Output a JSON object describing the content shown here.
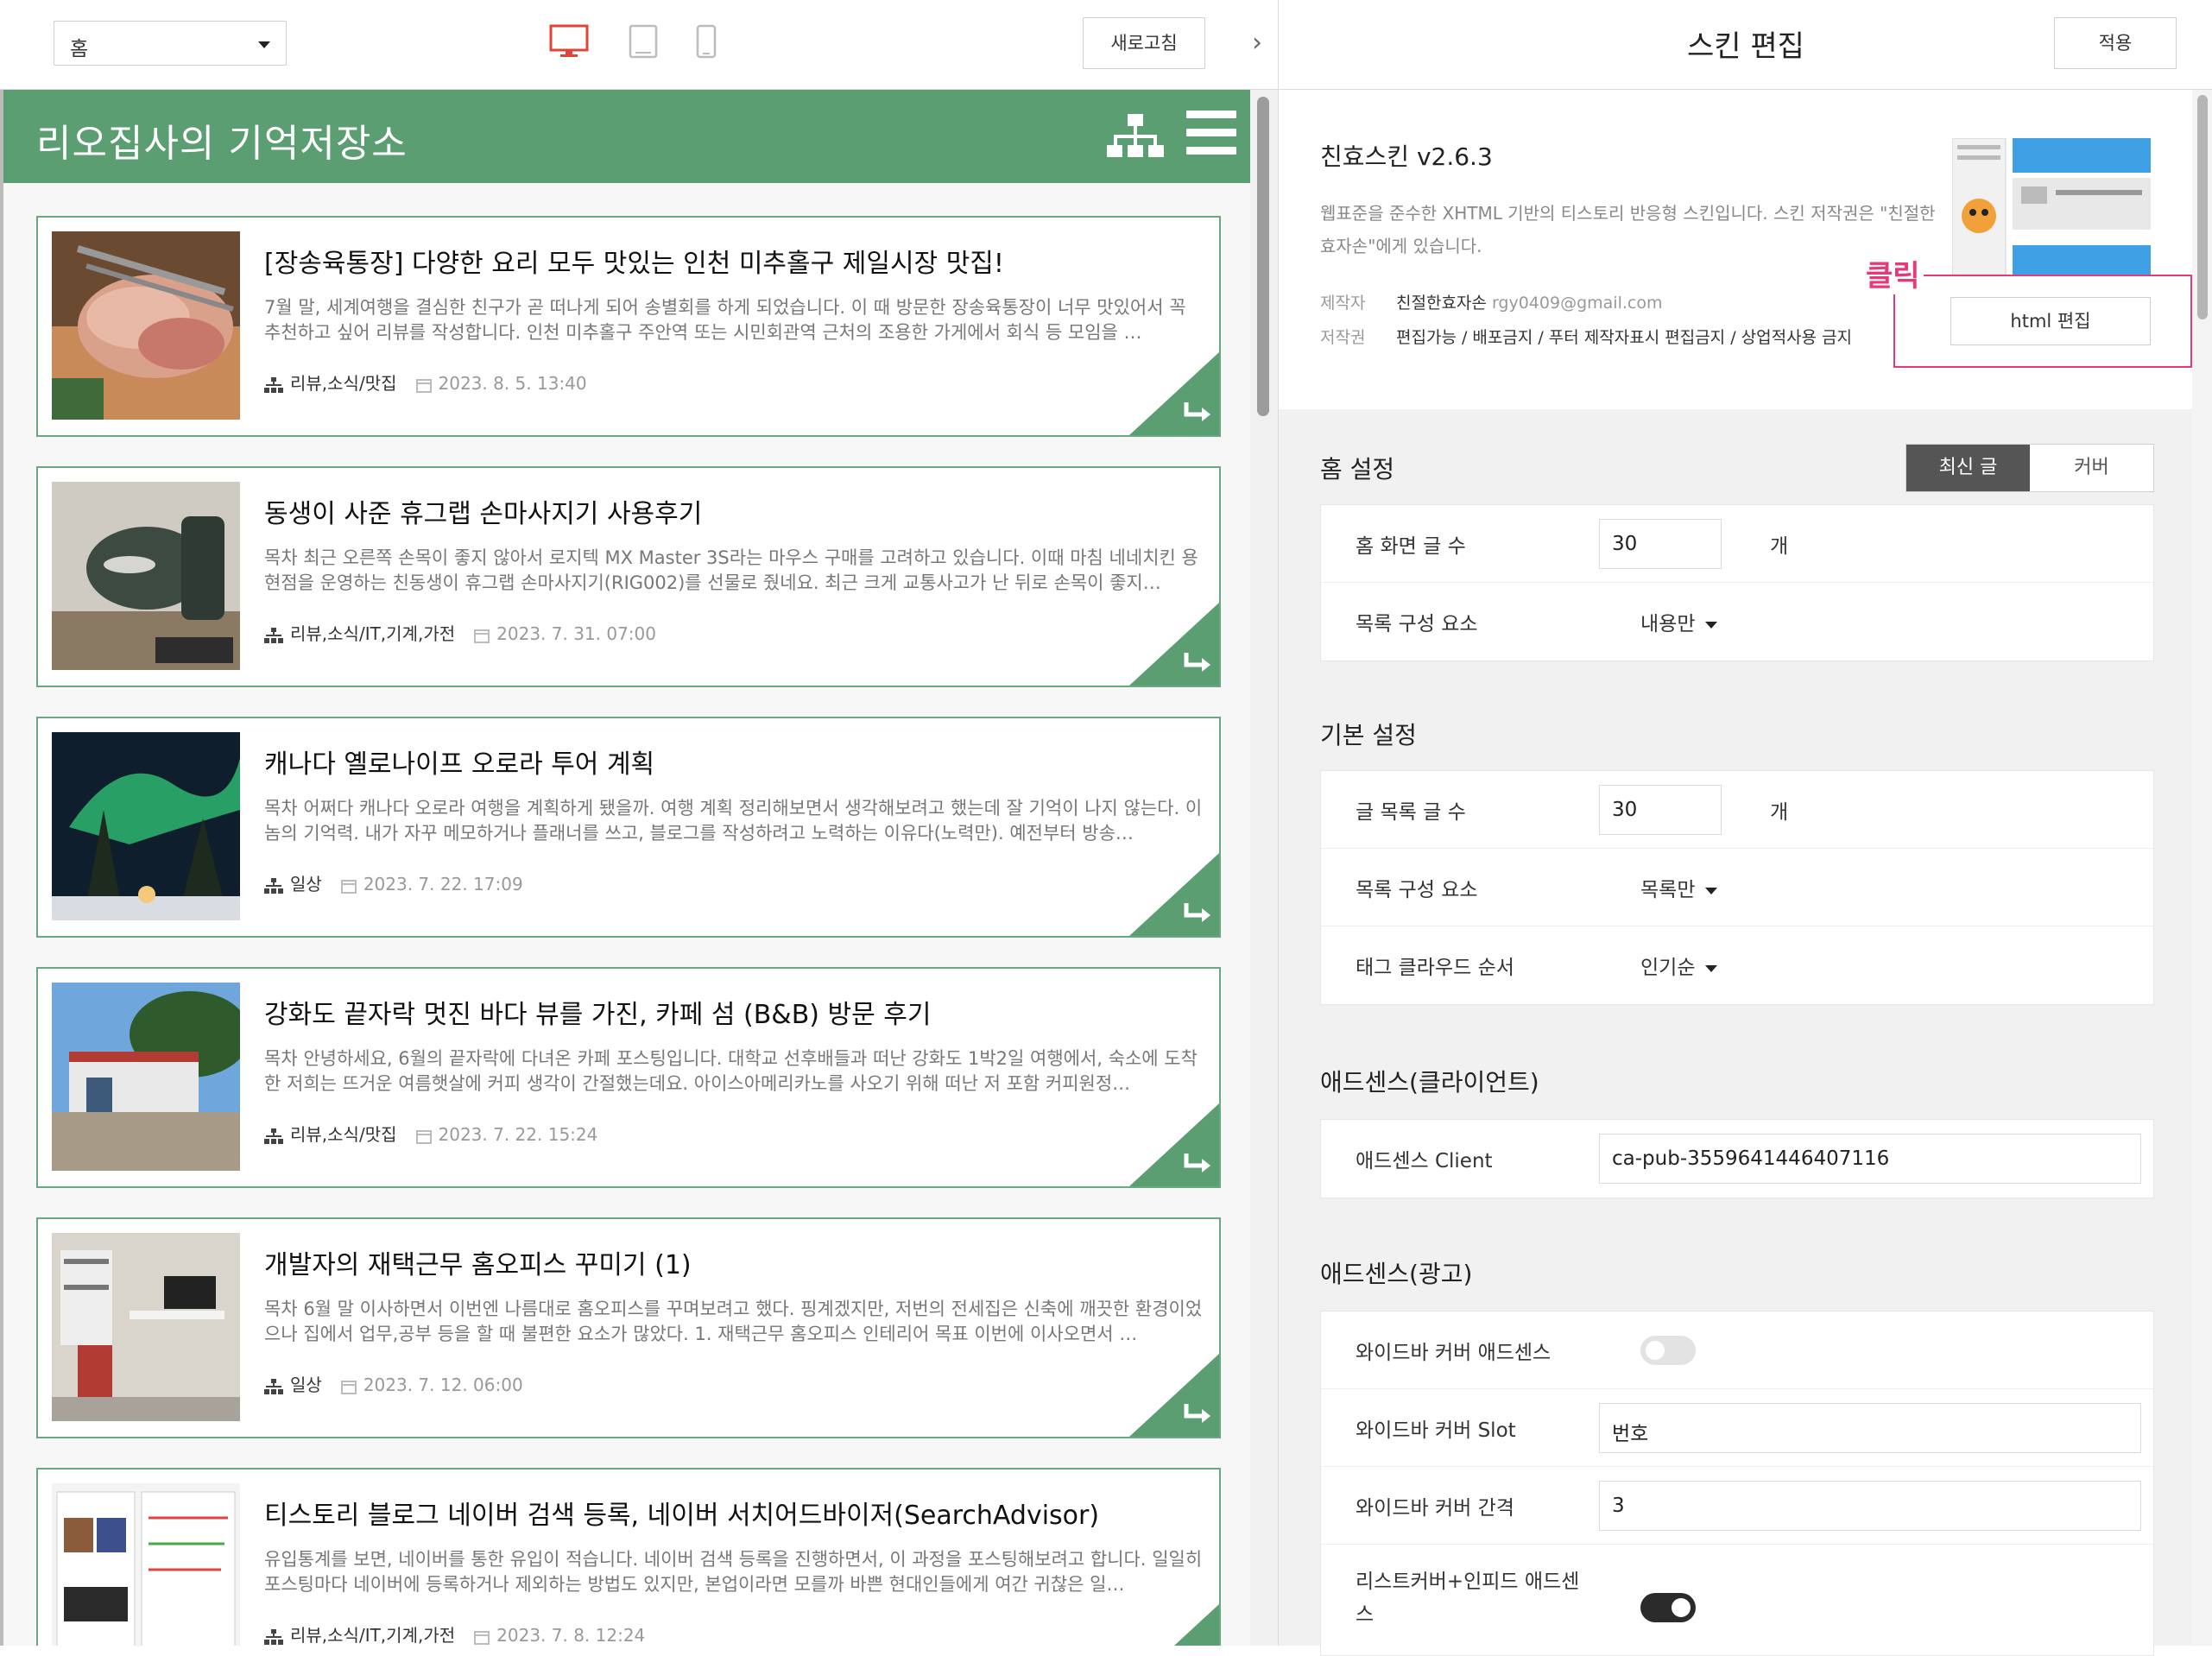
{
  "toolbar": {
    "page_select_value": "홈",
    "refresh_label": "새로고침",
    "collapse_glyph": "›"
  },
  "blog": {
    "title": "리오집사의 기억저장소",
    "posts": [
      {
        "title": "[장송육통장] 다양한 요리 모두 맛있는 인천 미추홀구 제일시장 맛집!",
        "excerpt": "7월 말, 세계여행을 결심한 친구가 곧 떠나게 되어 송별회를 하게 되었습니다. 이 때 방문한 장송육통장이 너무 맛있어서 꼭 추천하고 싶어 리뷰를 작성합니다. 인천 미추홀구 주안역 또는 시민회관역 근처의 조용한 가게에서 회식 등 모임을 …",
        "category": "리뷰,소식/맛집",
        "date": "2023. 8. 5. 13:40"
      },
      {
        "title": "동생이 사준 휴그랩 손마사지기 사용후기",
        "excerpt": "목차 최근 오른쪽 손목이 좋지 않아서 로지텍 MX Master 3S라는 마우스 구매를 고려하고 있습니다. 이때 마침 네네치킨 용현점을 운영하는 친동생이 휴그랩 손마사지기(RIG002)를 선물로 줬네요. 최근 크게 교통사고가 난 뒤로 손목이 좋지…",
        "category": "리뷰,소식/IT,기계,가전",
        "date": "2023. 7. 31. 07:00"
      },
      {
        "title": "캐나다 옐로나이프 오로라 투어 계획",
        "excerpt": "목차 어쩌다 캐나다 오로라 여행을 계획하게 됐을까. 여행 계획 정리해보면서 생각해보려고 했는데 잘 기억이 나지 않는다. 이놈의 기억력. 내가 자꾸 메모하거나 플래너를 쓰고, 블로그를 작성하려고 노력하는 이유다(노력만). 예전부터 방송…",
        "category": "일상",
        "date": "2023. 7. 22. 17:09"
      },
      {
        "title": "강화도 끝자락 멋진 바다 뷰를 가진, 카페 섬 (B&B) 방문 후기",
        "excerpt": "목차 안녕하세요, 6월의 끝자락에 다녀온 카페 포스팅입니다. 대학교 선후배들과 떠난 강화도 1박2일 여행에서, 숙소에 도착한 저희는 뜨거운 여름햇살에 커피 생각이 간절했는데요. 아이스아메리카노를 사오기 위해 떠난 저 포함 커피원정…",
        "category": "리뷰,소식/맛집",
        "date": "2023. 7. 22. 15:24"
      },
      {
        "title": "개발자의 재택근무 홈오피스 꾸미기 (1)",
        "excerpt": "목차 6월 말 이사하면서 이번엔 나름대로 홈오피스를 꾸며보려고 했다. 핑계겠지만, 저번의 전세집은 신축에 깨끗한 환경이었으나 집에서 업무,공부 등을 할 때 불편한 요소가 많았다. 1. 재택근무 홈오피스 인테리어 목표 이번에 이사오면서 …",
        "category": "일상",
        "date": "2023. 7. 12. 06:00"
      },
      {
        "title": "티스토리 블로그 네이버 검색 등록, 네이버 서치어드바이저(SearchAdvisor)",
        "excerpt": "유입통계를 보면, 네이버를 통한 유입이 적습니다. 네이버 검색 등록을 진행하면서, 이 과정을 포스팅해보려고 합니다. 일일히 포스팅마다 네이버에 등록하거나 제외하는 방법도 있지만, 본업이라면 모를까 바쁜 현대인들에게 여간 귀찮은 일…",
        "category": "리뷰,소식/IT,기계,가전",
        "date": "2023. 7. 8. 12:24"
      }
    ]
  },
  "panel": {
    "title": "스킨 편집",
    "apply_label": "적용",
    "skin": {
      "name": "친효스킨 v2.6.3",
      "description": "웹표준을 준수한 XHTML 기반의 티스토리 반응형 스킨입니다. 스킨 저작권은 \"친절한효자손\"에게 있습니다.",
      "maker_key": "제작자",
      "maker_name": "친절한효자손",
      "maker_email": "rgy0409@gmail.com",
      "copyright_key": "저작권",
      "copyright_value": "편집가능 / 배포금지 / 푸터 제작자표시 편집금지 / 상업적사용 금지",
      "html_edit_label": "html 편집"
    },
    "callout_label": "클릭",
    "home_settings": {
      "title": "홈 설정",
      "tab_recent": "최신 글",
      "tab_cover": "커버",
      "post_count_label": "홈 화면 글 수",
      "post_count_value": "30",
      "unit": "개",
      "list_items_label": "목록 구성 요소",
      "list_items_value": "내용만"
    },
    "basic_settings": {
      "title": "기본 설정",
      "list_count_label": "글 목록 글 수",
      "list_count_value": "30",
      "unit": "개",
      "list_items_label": "목록 구성 요소",
      "list_items_value": "목록만",
      "tag_cloud_label": "태그 클라우드 순서",
      "tag_cloud_value": "인기순"
    },
    "adsense_client": {
      "title": "애드센스(클라이언트)",
      "client_label": "애드센스 Client",
      "client_value": "ca-pub-3559641446407116"
    },
    "adsense_ads": {
      "title": "애드센스(광고)",
      "wide_cover_label": "와이드바 커버 애드센스",
      "wide_cover_on": false,
      "wide_slot_label": "와이드바 커버 Slot",
      "wide_slot_value": "번호",
      "wide_gap_label": "와이드바 커버 간격",
      "wide_gap_value": "3",
      "list_infeed_label": "리스트커버+인피드 애드센스",
      "list_infeed_on": true
    }
  },
  "colors": {
    "blog_green": "#5b9e71",
    "callout_pink": "#e5397a",
    "desktop_icon_red": "#e0443b"
  },
  "icons": {
    "device_desktop": "monitor-icon",
    "device_tablet": "tablet-icon",
    "device_mobile": "phone-icon",
    "sitemap": "sitemap-icon",
    "menu": "hamburger-menu-icon",
    "category": "category-icon",
    "date": "calendar-icon",
    "post_link": "return-arrow-icon"
  }
}
